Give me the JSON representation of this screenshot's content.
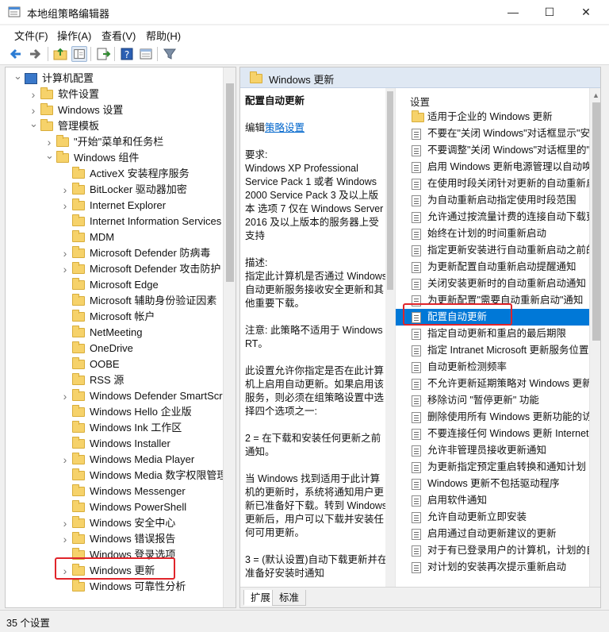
{
  "window": {
    "title": "本地组策略编辑器",
    "minimize_glyph": "—",
    "maximize_glyph": "☐",
    "close_glyph": "✕"
  },
  "menu": [
    "文件(F)",
    "操作(A)",
    "查看(V)",
    "帮助(H)"
  ],
  "toolbar": {
    "icons": [
      "back-icon",
      "forward-icon",
      "up-folder-icon",
      "show-hide-tree-icon",
      "export-list-icon",
      "help-icon",
      "properties-icon",
      "filter-icon"
    ]
  },
  "tree": {
    "items": [
      {
        "label": "计算机配置",
        "level": 0,
        "expand": "v"
      },
      {
        "label": "软件设置",
        "level": 1,
        "expand": ">"
      },
      {
        "label": "Windows 设置",
        "level": 1,
        "expand": ">"
      },
      {
        "label": "管理模板",
        "level": 1,
        "expand": "v"
      },
      {
        "label": "\"开始\"菜单和任务栏",
        "level": 2,
        "expand": ">"
      },
      {
        "label": "Windows 组件",
        "level": 2,
        "expand": "v"
      },
      {
        "label": "ActiveX 安装程序服务",
        "level": 3,
        "expand": ""
      },
      {
        "label": "BitLocker 驱动器加密",
        "level": 3,
        "expand": ">"
      },
      {
        "label": "Internet Explorer",
        "level": 3,
        "expand": ">"
      },
      {
        "label": "Internet Information Services",
        "level": 3,
        "expand": ""
      },
      {
        "label": "MDM",
        "level": 3,
        "expand": ""
      },
      {
        "label": "Microsoft Defender 防病毒",
        "level": 3,
        "expand": ">"
      },
      {
        "label": "Microsoft Defender 攻击防护",
        "level": 3,
        "expand": ">"
      },
      {
        "label": "Microsoft Edge",
        "level": 3,
        "expand": ""
      },
      {
        "label": "Microsoft 辅助身份验证因素",
        "level": 3,
        "expand": ""
      },
      {
        "label": "Microsoft 帐户",
        "level": 3,
        "expand": ""
      },
      {
        "label": "NetMeeting",
        "level": 3,
        "expand": ""
      },
      {
        "label": "OneDrive",
        "level": 3,
        "expand": ""
      },
      {
        "label": "OOBE",
        "level": 3,
        "expand": ""
      },
      {
        "label": "RSS 源",
        "level": 3,
        "expand": ""
      },
      {
        "label": "Windows Defender SmartScr",
        "level": 3,
        "expand": ">"
      },
      {
        "label": "Windows Hello 企业版",
        "level": 3,
        "expand": ""
      },
      {
        "label": "Windows Ink 工作区",
        "level": 3,
        "expand": ""
      },
      {
        "label": "Windows Installer",
        "level": 3,
        "expand": ""
      },
      {
        "label": "Windows Media Player",
        "level": 3,
        "expand": ">"
      },
      {
        "label": "Windows Media 数字权限管理",
        "level": 3,
        "expand": ""
      },
      {
        "label": "Windows Messenger",
        "level": 3,
        "expand": ""
      },
      {
        "label": "Windows PowerShell",
        "level": 3,
        "expand": ""
      },
      {
        "label": "Windows 安全中心",
        "level": 3,
        "expand": ">"
      },
      {
        "label": "Windows 错误报告",
        "level": 3,
        "expand": ">"
      },
      {
        "label": "Windows 登录选项",
        "level": 3,
        "expand": ""
      },
      {
        "label": "Windows 更新",
        "level": 3,
        "expand": ">",
        "highlighted": true
      },
      {
        "label": "Windows 可靠性分析",
        "level": 3,
        "expand": ""
      }
    ]
  },
  "detail": {
    "header_title": "Windows 更新",
    "description": {
      "title": "配置自动更新",
      "edit_prefix": "编辑",
      "edit_link": "策略设置",
      "paragraphs": [
        "要求:\nWindows XP Professional Service Pack 1 或者 Windows 2000 Service Pack 3 及以上版本 选项 7 仅在 Windows Server 2016 及以上版本的服务器上受支持",
        "描述:\n指定此计算机是否通过 Windows 自动更新服务接收安全更新和其他重要下载。",
        "注意: 此策略不适用于 Windows RT。",
        "此设置允许你指定是否在此计算机上启用自动更新。如果启用该服务，则必须在组策略设置中选择四个选项之一:",
        "2 = 在下载和安装任何更新之前通知。",
        "当 Windows 找到适用于此计算机的更新时，系统将通知用户更新已准备好下载。转到 Windows 更新后，用户可以下载并安装任何可用更新。",
        "3 = (默认设置)自动下载更新并在准备好安装时通知"
      ]
    },
    "settings_header": "设置",
    "settings": [
      {
        "label": "适用于企业的 Windows 更新",
        "folder": true
      },
      {
        "label": "不要在\"关闭 Windows\"对话框显示\"安装更新并关机\""
      },
      {
        "label": "不要调整\"关闭 Windows\"对话框里的\"安装更新并关机\"默认选项"
      },
      {
        "label": "启用 Windows 更新电源管理以自动唤醒系统来安装计划的更新"
      },
      {
        "label": "在使用时段关闭针对更新的自动重新启动"
      },
      {
        "label": "为自动重新启动指定使用时段范围"
      },
      {
        "label": "允许通过按流量计费的连接自动下载更新"
      },
      {
        "label": "始终在计划的时间重新启动"
      },
      {
        "label": "指定更新安装进行自动重新启动之前的截止日期"
      },
      {
        "label": "为更新配置自动重新启动提醒通知"
      },
      {
        "label": "关闭安装更新时的自动重新启动通知"
      },
      {
        "label": "为更新配置\"需要自动重新启动\"通知"
      },
      {
        "label": "配置自动更新",
        "selected": true
      },
      {
        "label": "指定自动更新和重启的最后期限"
      },
      {
        "label": "指定 Intranet Microsoft 更新服务位置"
      },
      {
        "label": "自动更新检测频率"
      },
      {
        "label": "不允许更新延期策略对 Windows 更新执行扫描"
      },
      {
        "label": "移除访问 \"暂停更新\" 功能"
      },
      {
        "label": "删除使用所有 Windows 更新功能的访问权限"
      },
      {
        "label": "不要连接任何 Windows 更新 Internet 位置"
      },
      {
        "label": "允许非管理员接收更新通知"
      },
      {
        "label": "为更新指定预定重启转换和通知计划"
      },
      {
        "label": "Windows 更新不包括驱动程序"
      },
      {
        "label": "启用软件通知"
      },
      {
        "label": "允许自动更新立即安装"
      },
      {
        "label": "启用通过自动更新建议的更新"
      },
      {
        "label": "对于有已登录用户的计算机，计划的自动更新安装不执行重新启动"
      },
      {
        "label": "对计划的安装再次提示重新启动"
      }
    ],
    "tabs": [
      "扩展",
      "标准"
    ]
  },
  "status": {
    "text": "35 个设置"
  },
  "colors": {
    "selection": "#0078d7",
    "highlight_box": "#e0252b",
    "header_bg": "#dfe8f3"
  }
}
